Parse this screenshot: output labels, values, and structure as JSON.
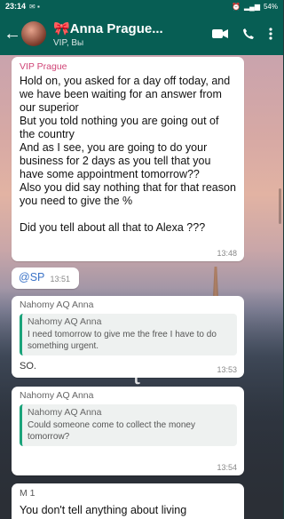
{
  "status": {
    "time": "23:14",
    "battery": "54%"
  },
  "header": {
    "title": "Anna Prague...",
    "subtitle": "VIP, Вы"
  },
  "messages": [
    {
      "sender": "VIP Prague",
      "text": "Hold on, you asked for a day off today, and we have been waiting for an answer from our superior\nBut you told nothing you are going out of the country\nAnd as I see, you are going to do your business  for 2 days as you tell that you have some appointment tomorrow??\nAlso you did say nothing that for that reason you need to give the %\n\nDid you tell about all that to Alexa ???",
      "time": "13:48"
    },
    {
      "text": "@SP",
      "time": "13:51"
    },
    {
      "header": "Nahomy AQ  Anna",
      "quote_name": "Nahomy AQ  Anna",
      "quote_text": "I need tomorrow to give me the free I have to do something urgent.",
      "reply": "SO.",
      "time": "13:53"
    },
    {
      "header": "Nahomy AQ  Anna",
      "quote_name": "Nahomy AQ  Anna",
      "quote_text": "Could someone come to collect the money tomorrow?",
      "time": "13:54"
    },
    {
      "sender": "M 1",
      "text": "You don't tell anything about living"
    }
  ],
  "watermark": "t"
}
